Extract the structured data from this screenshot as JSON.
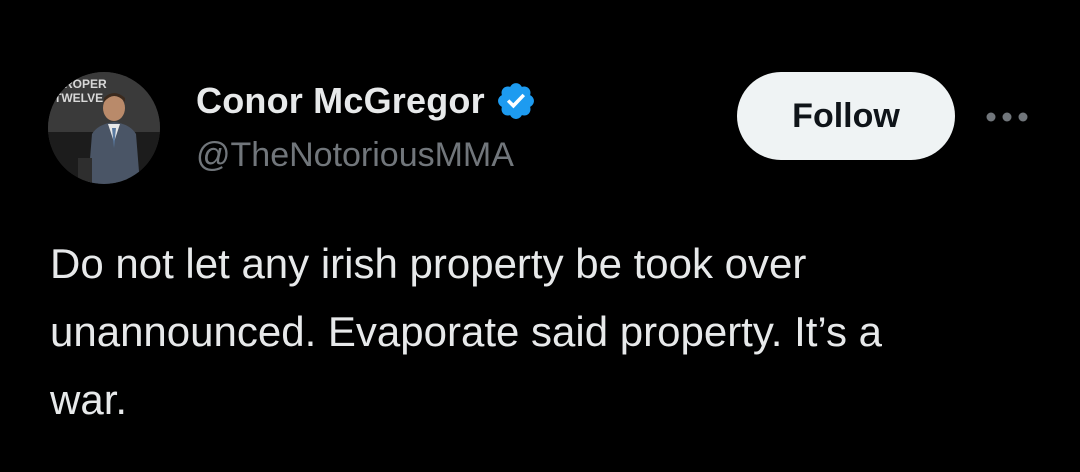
{
  "author": {
    "display_name": "Conor McGregor",
    "handle": "@TheNotoriousMMA",
    "verified": true,
    "avatar_text": [
      "PROPER",
      "TWELVE"
    ]
  },
  "actions": {
    "follow_label": "Follow",
    "more_icon": "more-horizontal-icon"
  },
  "tweet": {
    "lines": [
      "Do not let any irish property be took over",
      "unannounced. Evaporate said property. It’s a",
      "war."
    ]
  },
  "colors": {
    "background": "#000000",
    "text_primary": "#e7e9ea",
    "text_secondary": "#71767b",
    "verified_blue": "#1d9bf0",
    "follow_button_bg": "#eff3f4",
    "follow_button_text": "#0f1419"
  }
}
